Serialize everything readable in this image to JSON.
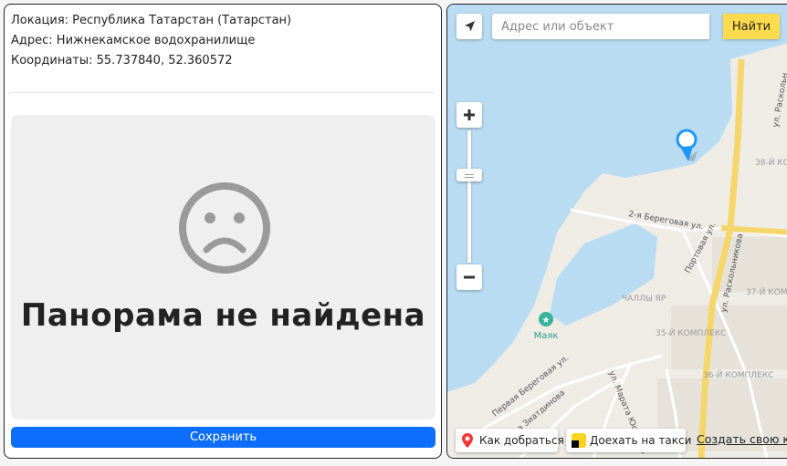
{
  "info": {
    "location": "Локация: Республика Татарстан (Татарстан)",
    "address": "Адрес: Нижнекамское водохранилище",
    "coords": "Координаты: 55.737840, 52.360572"
  },
  "panorama": {
    "message": "Панорама не найдена",
    "icon": "sad-face-icon"
  },
  "save_button": "Сохранить",
  "map": {
    "search_placeholder": "Адрес или объект",
    "search_button": "Найти",
    "labels": {
      "majak": "Маяк",
      "chally_yar": "ЧАЛЛЫ ЯР",
      "kompleks_35": "35-Й КОМПЛЕКС",
      "kompleks_36": "36-Й КОМПЛЕКС",
      "kompleks_37": "37-Й КОМ",
      "kompleks_38": "38-Й КОМ",
      "beregovaya_2": "2-я Береговая ул.",
      "portovaya": "Портовая ул.",
      "raskolnikova_ul": "ул. Раскольникова",
      "raskolnikova_vert": "ул. Раскольн",
      "marata": "ул. Марата Юсупова",
      "pervaya_beregovaya": "Первая Береговая ул.",
      "zinatdinova": "ла Зиатдинова"
    },
    "route_button": "Как добраться",
    "taxi_button": "Доехать на такси",
    "create_link": "Создать свою ка"
  }
}
